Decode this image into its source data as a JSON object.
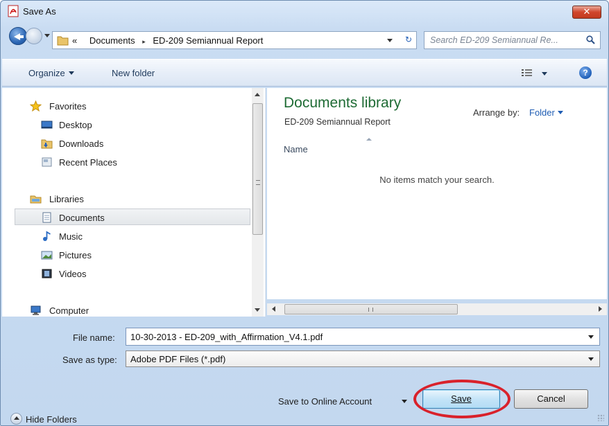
{
  "window": {
    "title": "Save As",
    "close_label": "✕",
    "title_icon": "pdf-document-icon"
  },
  "address": {
    "overflow": "«",
    "crumbs": [
      "Documents",
      "ED-209 Semiannual Report"
    ],
    "separator": "▸",
    "refresh_glyph": "↻"
  },
  "search": {
    "placeholder": "Search ED-209 Semiannual Re..."
  },
  "toolbar": {
    "organize": "Organize",
    "new_folder": "New folder",
    "help": "?"
  },
  "navigation": {
    "items": [
      {
        "label": "Favorites",
        "icon": "star-icon"
      },
      {
        "label": "Desktop",
        "icon": "desktop-icon"
      },
      {
        "label": "Downloads",
        "icon": "downloads-folder-icon"
      },
      {
        "label": "Recent Places",
        "icon": "recent-places-icon"
      },
      {
        "label": "Libraries",
        "icon": "libraries-icon"
      },
      {
        "label": "Documents",
        "icon": "documents-icon",
        "selected": true
      },
      {
        "label": "Music",
        "icon": "music-icon"
      },
      {
        "label": "Pictures",
        "icon": "pictures-icon"
      },
      {
        "label": "Videos",
        "icon": "videos-icon"
      },
      {
        "label": "Computer",
        "icon": "computer-icon"
      }
    ]
  },
  "content": {
    "library_title": "Documents library",
    "library_subtitle": "ED-209 Semiannual Report",
    "arrange_label": "Arrange by:",
    "arrange_value": "Folder",
    "column_name": "Name",
    "empty_message": "No items match your search."
  },
  "form": {
    "file_name_label": "File name:",
    "file_name_value": "10-30-2013 - ED-209_with_Affirmation_V4.1.pdf",
    "save_type_label": "Save as type:",
    "save_type_value": "Adobe PDF Files (*.pdf)"
  },
  "footer": {
    "hide_folders": "Hide Folders",
    "online_account": "Save to Online Account",
    "save": "Save",
    "cancel": "Cancel"
  },
  "colors": {
    "library_title": "#1e6b34",
    "link_blue": "#1e5cb3",
    "highlight_ring": "#d9212b"
  }
}
